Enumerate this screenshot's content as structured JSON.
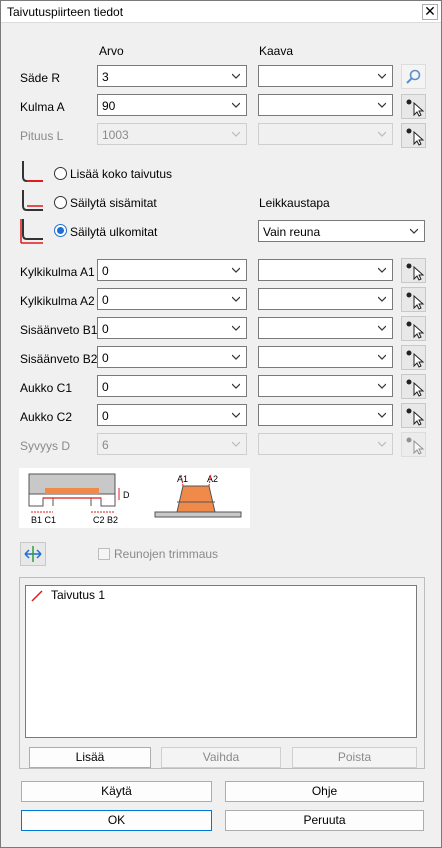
{
  "window": {
    "title": "Taivutuspiirteen tiedot",
    "close_glyph": "✕"
  },
  "columns": {
    "value_header": "Arvo",
    "formula_header": "Kaava"
  },
  "rows": [
    {
      "label": "Säde R",
      "value": "3",
      "formula": "",
      "disabled": false,
      "icon": "search-icon"
    },
    {
      "label": "Kulma A",
      "value": "90",
      "formula": "",
      "disabled": false,
      "icon": "pick-point-icon"
    },
    {
      "label": "Pituus L",
      "value": "1003",
      "formula": "",
      "disabled": true,
      "icon": "pick-point-icon"
    }
  ],
  "bend_options": {
    "items": [
      {
        "label": "Lisää koko taivutus",
        "selected": false
      },
      {
        "label": "Säilytä sisämitat",
        "selected": false
      },
      {
        "label": "Säilytä ulkomitat",
        "selected": true
      }
    ],
    "cut_label": "Leikkaustapa",
    "cut_value": "Vain reuna"
  },
  "relief_rows": [
    {
      "label": "Kylkikulma A1",
      "value": "0",
      "formula": "",
      "disabled": false
    },
    {
      "label": "Kylkikulma A2",
      "value": "0",
      "formula": "",
      "disabled": false
    },
    {
      "label": "Sisäänveto B1",
      "value": "0",
      "formula": "",
      "disabled": false
    },
    {
      "label": "Sisäänveto B2",
      "value": "0",
      "formula": "",
      "disabled": false
    },
    {
      "label": "Aukko C1",
      "value": "0",
      "formula": "",
      "disabled": false
    },
    {
      "label": "Aukko C2",
      "value": "0",
      "formula": "",
      "disabled": false
    },
    {
      "label": "Syvyys D",
      "value": "6",
      "formula": "",
      "disabled": true
    }
  ],
  "diagram": {
    "left_labels": {
      "d": "D",
      "b1c1": "B1 C1",
      "c2b2": "C2 B2"
    },
    "right_labels": {
      "a1": "A1",
      "a2": "A2"
    },
    "colors": {
      "orange": "#f08a4b",
      "red": "#e01b1b",
      "gray": "#c8c8c8",
      "dark": "#555555"
    }
  },
  "trim": {
    "label": "Reunojen trimmaus",
    "checked": false,
    "disabled": true
  },
  "list": {
    "items": [
      {
        "label": "Taivutus 1",
        "icon": "bend-line-icon"
      }
    ]
  },
  "list_buttons": {
    "add": "Lisää",
    "change": "Vaihda",
    "remove": "Poista"
  },
  "footer": {
    "apply": "Käytä",
    "help": "Ohje",
    "ok": "OK",
    "cancel": "Peruuta"
  }
}
